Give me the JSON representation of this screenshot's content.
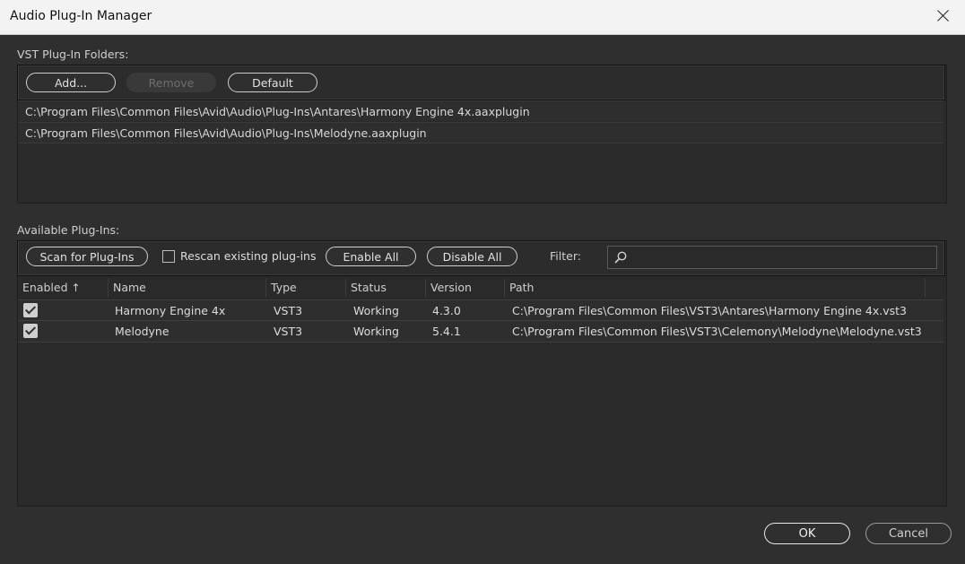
{
  "window": {
    "title": "Audio Plug-In Manager"
  },
  "vst_folders": {
    "label": "VST Plug-In Folders:",
    "add_label": "Add...",
    "remove_label": "Remove",
    "default_label": "Default",
    "paths": [
      "C:\\Program Files\\Common Files\\Avid\\Audio\\Plug-Ins\\Antares\\Harmony Engine 4x.aaxplugin",
      "C:\\Program Files\\Common Files\\Avid\\Audio\\Plug-Ins\\Melodyne.aaxplugin"
    ]
  },
  "available": {
    "label": "Available Plug-Ins:",
    "scan_label": "Scan for Plug-Ins",
    "rescan_label": "Rescan existing plug-ins",
    "rescan_checked": false,
    "enable_all_label": "Enable All",
    "disable_all_label": "Disable All",
    "filter_label": "Filter:",
    "filter_value": "",
    "columns": {
      "enabled": "Enabled",
      "name": "Name",
      "type": "Type",
      "status": "Status",
      "version": "Version",
      "path": "Path"
    },
    "sort_indicator": "↑",
    "rows": [
      {
        "enabled": true,
        "name": "Harmony Engine 4x",
        "type": "VST3",
        "status": "Working",
        "version": "4.3.0",
        "path": "C:\\Program Files\\Common Files\\VST3\\Antares\\Harmony Engine 4x.vst3"
      },
      {
        "enabled": true,
        "name": "Melodyne",
        "type": "VST3",
        "status": "Working",
        "version": "5.4.1",
        "path": "C:\\Program Files\\Common Files\\VST3\\Celemony\\Melodyne\\Melodyne.vst3"
      }
    ]
  },
  "footer": {
    "ok_label": "OK",
    "cancel_label": "Cancel"
  }
}
